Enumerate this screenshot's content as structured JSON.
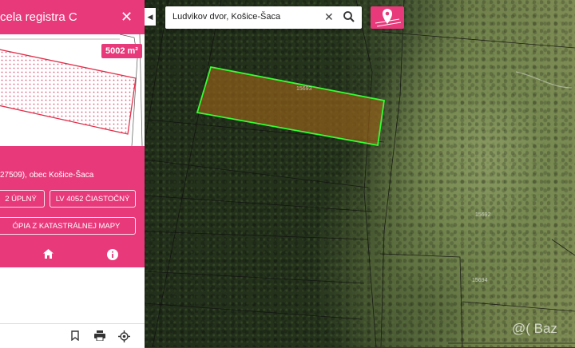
{
  "panel": {
    "title": "cela registra C",
    "close_glyph": "✕",
    "area_badge": "5002 m²",
    "address": "27509), obec Košice-Šaca",
    "buttons": {
      "lv_full": "2 ÚPLNÝ",
      "lv_partial": "LV 4052 ČIASTOČNÝ",
      "kopia": "ÓPIA Z KATASTRÁLNEJ MAPY"
    },
    "tabs": [
      {
        "icon": "home-icon"
      },
      {
        "icon": "info-icon"
      }
    ],
    "bottom_icons": [
      "bookmark-icon",
      "print-icon",
      "locate-icon"
    ]
  },
  "search": {
    "value": "Ludvikov dvor, Košice-Šaca",
    "clear_glyph": "✕"
  },
  "collapse_glyph": "◀",
  "map": {
    "parcel_labels": [
      "15692",
      "15693",
      "15694"
    ]
  },
  "watermark": "@( Baz",
  "colors": {
    "accent": "#e8397a",
    "parcel_outline": "#33ff33",
    "parcel_fill": "#a0661a"
  }
}
